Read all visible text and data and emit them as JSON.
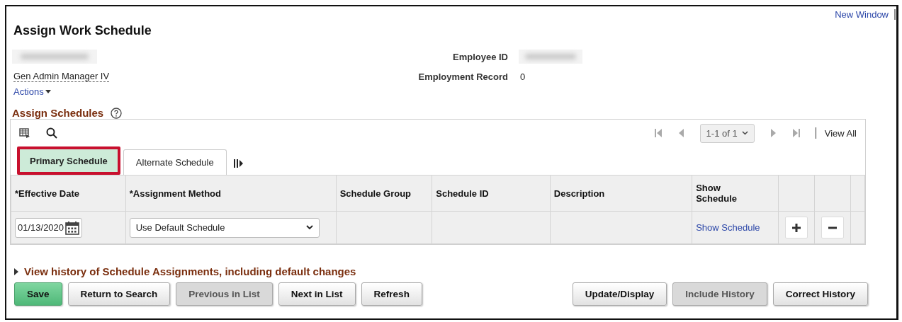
{
  "header_link": "New Window",
  "title": "Assign Work Schedule",
  "job_title": "Gen Admin Manager IV",
  "actions_link": "Actions",
  "fields": [
    {
      "label": "Employee ID"
    },
    {
      "label": "Employment Record",
      "value": "0"
    }
  ],
  "section": {
    "title": "Assign Schedules"
  },
  "pager": {
    "range": "1-1 of 1",
    "view_all": "View All"
  },
  "tabs": [
    {
      "label": "Primary Schedule",
      "selected": true,
      "highlighted": true
    },
    {
      "label": "Alternate Schedule",
      "selected": false,
      "highlighted": false
    }
  ],
  "table": {
    "columns": [
      "*Effective Date",
      "*Assignment Method",
      "Schedule Group",
      "Schedule ID",
      "Description",
      "Show Schedule"
    ],
    "rows": [
      {
        "effective_date": "01/13/2020",
        "assignment_method": "Use Default Schedule",
        "show_schedule": "Show Schedule"
      }
    ]
  },
  "history_link": "View history of Schedule Assignments, including default changes",
  "buttons_left": [
    {
      "label": "Save",
      "kind": "primary",
      "disabled": false
    },
    {
      "label": "Return to Search",
      "kind": "normal",
      "disabled": false
    },
    {
      "label": "Previous in List",
      "kind": "normal",
      "disabled": true
    },
    {
      "label": "Next in List",
      "kind": "normal",
      "disabled": false
    },
    {
      "label": "Refresh",
      "kind": "normal",
      "disabled": false
    }
  ],
  "buttons_right": [
    {
      "label": "Update/Display",
      "kind": "normal",
      "disabled": false
    },
    {
      "label": "Include History",
      "kind": "normal",
      "disabled": true
    },
    {
      "label": "Correct History",
      "kind": "normal",
      "disabled": false
    }
  ]
}
